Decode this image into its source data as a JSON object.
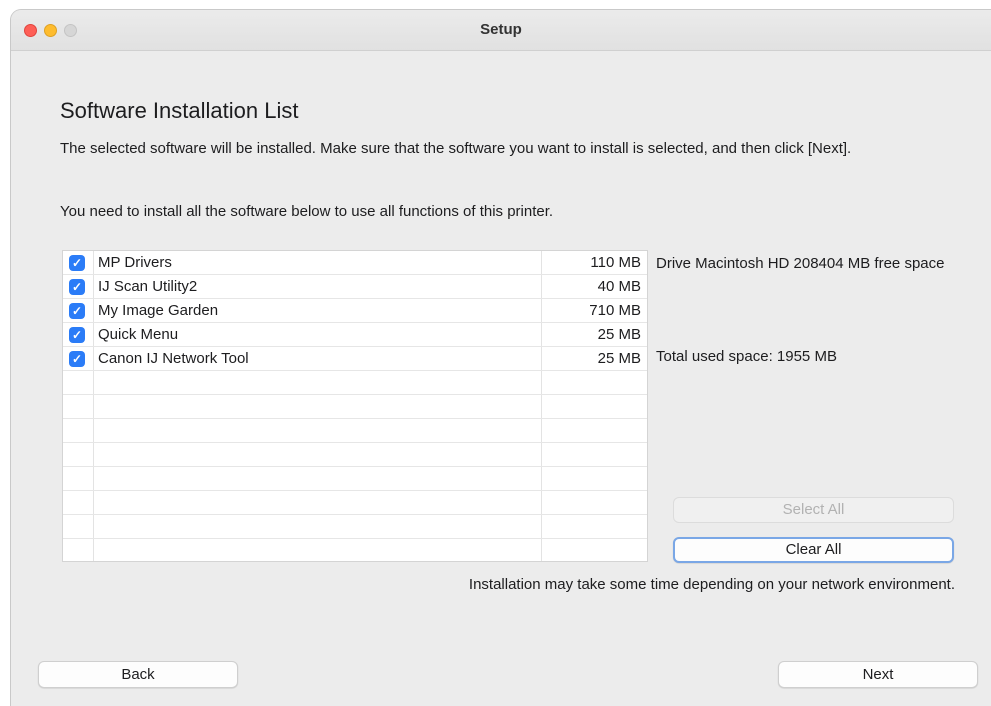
{
  "window": {
    "title": "Setup"
  },
  "heading": "Software Installation List",
  "description": "The selected software will be installed. Make sure that the software you want to install is selected, and then click [Next].",
  "description2": "You need to install all the software below to use all functions of this printer.",
  "software": [
    {
      "name": "MP Drivers",
      "size": "110 MB",
      "checked": true
    },
    {
      "name": "IJ Scan Utility2",
      "size": "40 MB",
      "checked": true
    },
    {
      "name": "My Image Garden",
      "size": "710 MB",
      "checked": true
    },
    {
      "name": "Quick Menu",
      "size": "25 MB",
      "checked": true
    },
    {
      "name": "Canon IJ Network Tool",
      "size": "25 MB",
      "checked": true
    }
  ],
  "drive_info": "Drive Macintosh HD 208404 MB free space",
  "total_used": "Total used space: 1955 MB",
  "buttons": {
    "select_all": "Select All",
    "clear_all": "Clear All",
    "back": "Back",
    "next": "Next"
  },
  "note": "Installation may take some time depending on your network environment.",
  "colors": {
    "accent": "#2b7cf7",
    "focus_ring": "#7aa7e6"
  }
}
